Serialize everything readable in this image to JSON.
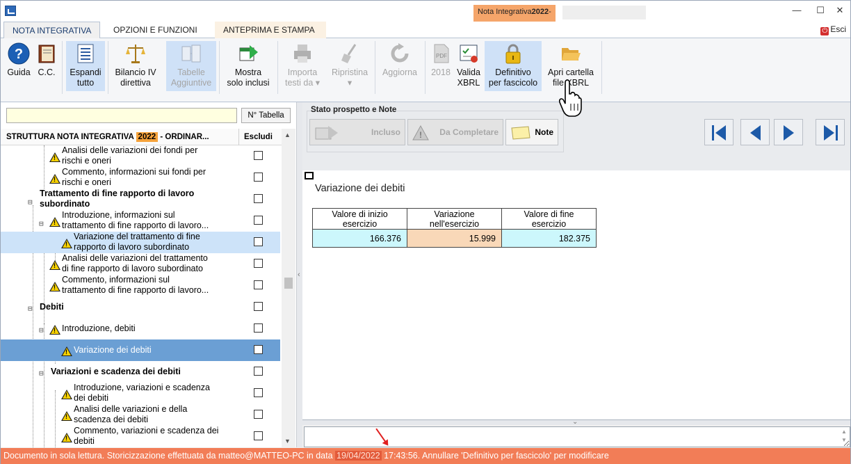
{
  "window": {
    "title_prefix": "Nota Integrativa",
    "title_year": "2022",
    "title_suffix": "-",
    "minimize": "—",
    "maximize": "☐",
    "close": "✕"
  },
  "tabs": [
    {
      "label": "NOTA INTEGRATIVA",
      "active": true
    },
    {
      "label": "OPZIONI E FUNZIONI",
      "active": false
    },
    {
      "label": "ANTEPRIMA E STAMPA",
      "active": false
    }
  ],
  "esci_label": "Esci",
  "ribbon": {
    "guida": "Guida",
    "cc": "C.C.",
    "espandi_1": "Espandi",
    "espandi_2": "tutto",
    "bilancio_1": "Bilancio IV",
    "bilancio_2": "direttiva",
    "tabelle_1": "Tabelle",
    "tabelle_2": "Aggiuntive",
    "mostra_1": "Mostra",
    "mostra_2": "solo inclusi",
    "importa_1": "Importa",
    "importa_2": "testi da ▾",
    "ripristina_1": "Ripristina",
    "ripristina_2": "▾",
    "aggiorna": "Aggiorna",
    "anno": "2018",
    "valida_1": "Valida",
    "valida_2": "XBRL",
    "definitivo_1": "Definitivo",
    "definitivo_2": "per fascicolo",
    "apri_1": "Apri cartella",
    "apri_2": "file XBRL"
  },
  "left_panel": {
    "search_value": "",
    "ntabella_label": "N° Tabella",
    "header_title_pre": "STRUTTURA NOTA INTEGRATIVA",
    "header_year": "2022",
    "header_title_post": "- ORDINAR...",
    "header_escludi": "Escludi"
  },
  "tree": {
    "r1a": "Analisi delle variazioni dei fondi per",
    "r1b": "rischi e oneri",
    "r2a": "Commento, informazioni sui fondi per",
    "r2b": "rischi e oneri",
    "r3a": "Trattamento di fine rapporto di lavoro",
    "r3b": "subordinato",
    "r4a": "Introduzione, informazioni sul",
    "r4b": "trattamento di fine rapporto di lavoro...",
    "r5a": "Variazione del trattamento di fine",
    "r5b": "rapporto di lavoro subordinato",
    "r6a": "Analisi delle variazioni del trattamento",
    "r6b": "di fine rapporto di lavoro subordinato",
    "r7a": "Commento, informazioni sul",
    "r7b": "trattamento di fine rapporto di lavoro...",
    "r8": "Debiti",
    "r9": "Introduzione, debiti",
    "r10": "Variazione dei debiti",
    "r11": "Variazioni e scadenza dei debiti",
    "r12a": "Introduzione, variazioni e scadenza",
    "r12b": "dei debiti",
    "r13a": "Analisi delle variazioni e della",
    "r13b": "scadenza dei debiti",
    "r14a": "Commento, variazioni e scadenza dei",
    "r14b": "debiti"
  },
  "stato": {
    "label": "Stato prospetto e Note",
    "incluso": "Incluso",
    "da_completare": "Da Completare",
    "note": "Note"
  },
  "content": {
    "title": "Variazione dei debiti",
    "headers": [
      [
        "Valore di inizio",
        "esercizio"
      ],
      [
        "Variazione",
        "nell'esercizio"
      ],
      [
        "Valore di fine",
        "esercizio"
      ]
    ],
    "values": [
      "166.376",
      "15.999",
      "182.375"
    ],
    "colors": {
      "cyan": "#ccf7fc",
      "peach": "#f9d8b8"
    }
  },
  "statusbar": {
    "pre": "Documento in sola lettura. Storicizzazione effettuata da matteo@MATTEO-PC in data ",
    "date": "19/04/2022",
    "post": " 17:43:56. Annullare 'Definitivo per fascicolo' per modificare"
  },
  "colors": {
    "status_bg": "#f27d57",
    "title_accent": "#f5a56a",
    "selection_dark": "#6b9fd4",
    "selection_light": "#cde3f9"
  }
}
